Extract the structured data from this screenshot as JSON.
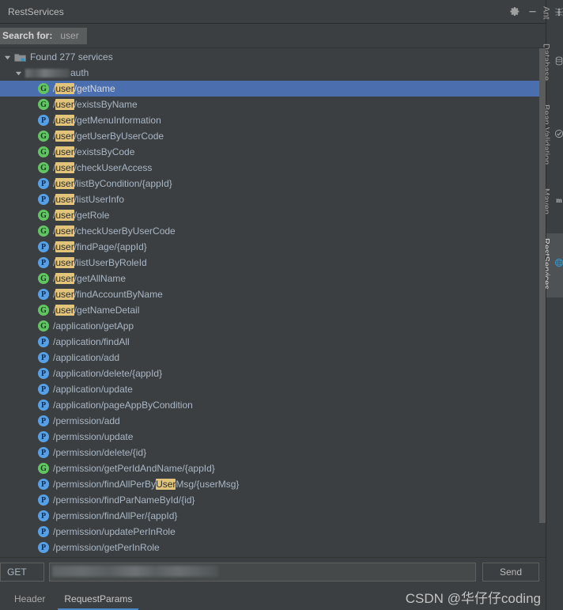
{
  "window": {
    "title": "RestServices",
    "settings_icon": "gear-icon",
    "minimize_icon": "minimize-icon"
  },
  "search": {
    "label": "Search for:",
    "value": "user"
  },
  "tree": {
    "root": {
      "label": "Found 277 services",
      "icon": "folder-icon",
      "expanded": true
    },
    "group": {
      "label": "auth",
      "redacted_prefix": true,
      "expanded": true
    },
    "endpoints": [
      {
        "method": "G",
        "prefix": "/",
        "highlight": "user",
        "suffix": "/getName",
        "selected": true
      },
      {
        "method": "G",
        "prefix": "/",
        "highlight": "user",
        "suffix": "/existsByName",
        "selected": false
      },
      {
        "method": "P",
        "prefix": "/",
        "highlight": "user",
        "suffix": "/getMenuInformation",
        "selected": false
      },
      {
        "method": "G",
        "prefix": "/",
        "highlight": "user",
        "suffix": "/getUserByUserCode",
        "selected": false
      },
      {
        "method": "G",
        "prefix": "/",
        "highlight": "user",
        "suffix": "/existsByCode",
        "selected": false
      },
      {
        "method": "G",
        "prefix": "/",
        "highlight": "user",
        "suffix": "/checkUserAccess",
        "selected": false
      },
      {
        "method": "P",
        "prefix": "/",
        "highlight": "user",
        "suffix": "/listByCondition/{appId}",
        "selected": false
      },
      {
        "method": "P",
        "prefix": "/",
        "highlight": "user",
        "suffix": "/listUserInfo",
        "selected": false
      },
      {
        "method": "G",
        "prefix": "/",
        "highlight": "user",
        "suffix": "/getRole",
        "selected": false
      },
      {
        "method": "G",
        "prefix": "/",
        "highlight": "user",
        "suffix": "/checkUserByUserCode",
        "selected": false
      },
      {
        "method": "P",
        "prefix": "/",
        "highlight": "user",
        "suffix": "/findPage/{appId}",
        "selected": false
      },
      {
        "method": "P",
        "prefix": "/",
        "highlight": "user",
        "suffix": "/listUserByRoleId",
        "selected": false
      },
      {
        "method": "G",
        "prefix": "/",
        "highlight": "user",
        "suffix": "/getAllName",
        "selected": false
      },
      {
        "method": "P",
        "prefix": "/",
        "highlight": "user",
        "suffix": "/findAccountByName",
        "selected": false
      },
      {
        "method": "G",
        "prefix": "/",
        "highlight": "user",
        "suffix": "/getNameDetail",
        "selected": false
      },
      {
        "method": "G",
        "prefix": "/application/getApp",
        "highlight": "",
        "suffix": "",
        "selected": false
      },
      {
        "method": "P",
        "prefix": "/application/findAll",
        "highlight": "",
        "suffix": "",
        "selected": false
      },
      {
        "method": "P",
        "prefix": "/application/add",
        "highlight": "",
        "suffix": "",
        "selected": false
      },
      {
        "method": "P",
        "prefix": "/application/delete/{appId}",
        "highlight": "",
        "suffix": "",
        "selected": false
      },
      {
        "method": "P",
        "prefix": "/application/update",
        "highlight": "",
        "suffix": "",
        "selected": false
      },
      {
        "method": "P",
        "prefix": "/application/pageAppByCondition",
        "highlight": "",
        "suffix": "",
        "selected": false
      },
      {
        "method": "P",
        "prefix": "/permission/add",
        "highlight": "",
        "suffix": "",
        "selected": false
      },
      {
        "method": "P",
        "prefix": "/permission/update",
        "highlight": "",
        "suffix": "",
        "selected": false
      },
      {
        "method": "P",
        "prefix": "/permission/delete/{id}",
        "highlight": "",
        "suffix": "",
        "selected": false
      },
      {
        "method": "G",
        "prefix": "/permission/getPerIdAndName/{appId}",
        "highlight": "",
        "suffix": "",
        "selected": false
      },
      {
        "method": "P",
        "prefix": "/permission/findAllPerBy",
        "highlight": "User",
        "suffix": "Msg/{userMsg}",
        "selected": false
      },
      {
        "method": "P",
        "prefix": "/permission/findParNameById/{id}",
        "highlight": "",
        "suffix": "",
        "selected": false
      },
      {
        "method": "P",
        "prefix": "/permission/findAllPer/{appId}",
        "highlight": "",
        "suffix": "",
        "selected": false
      },
      {
        "method": "P",
        "prefix": "/permission/updatePerInRole",
        "highlight": "",
        "suffix": "",
        "selected": false
      },
      {
        "method": "P",
        "prefix": "/permission/getPerInRole",
        "highlight": "",
        "suffix": "",
        "selected": false
      }
    ]
  },
  "request": {
    "method": "GET",
    "url_value": "",
    "send_label": "Send"
  },
  "tabs": [
    {
      "label": "Header",
      "active": false
    },
    {
      "label": "RequestParams",
      "active": true
    }
  ],
  "watermark": "CSDN @华仔仔coding",
  "right_tabs": [
    {
      "label": "Ant",
      "icon": "ant-icon",
      "active": false
    },
    {
      "label": "Database",
      "icon": "database-icon",
      "active": false
    },
    {
      "label": "Bean Validation",
      "icon": "bean-validation-icon",
      "active": false
    },
    {
      "label": "Maven",
      "icon": "maven-icon",
      "active": false
    },
    {
      "label": "RestServices",
      "icon": "rest-services-icon",
      "active": true
    }
  ],
  "colors": {
    "background": "#3c3f41",
    "selection": "#4b6eaf",
    "get_badge": "#62c462",
    "post_badge": "#56a0e8",
    "highlight": "#e2c57a",
    "accent": "#4a88c7"
  }
}
